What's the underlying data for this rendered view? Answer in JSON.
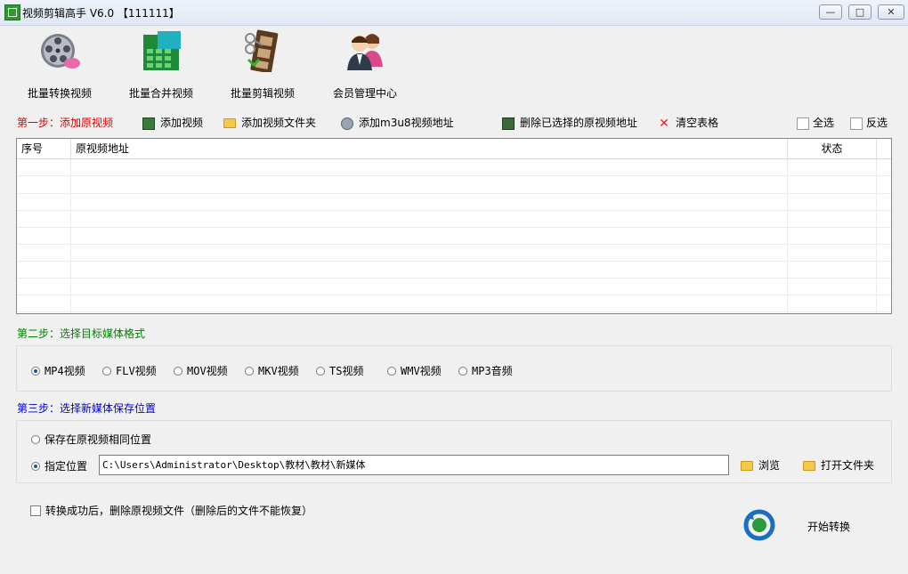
{
  "window": {
    "title": "视频剪辑高手 V6.0  【111111】",
    "buttons": {
      "minimize": "—",
      "maximize": "□",
      "close": "✕"
    }
  },
  "toolbar": {
    "items": [
      {
        "label": "批量转换视频",
        "icon": "film-reel-icon"
      },
      {
        "label": "批量合并视频",
        "icon": "merge-grid-icon"
      },
      {
        "label": "批量剪辑视频",
        "icon": "film-scissors-icon"
      },
      {
        "label": "会员管理中心",
        "icon": "users-icon"
      }
    ]
  },
  "step1": {
    "title": "第一步：添加原视频",
    "actions": {
      "add_video": "添加视频",
      "add_folder": "添加视频文件夹",
      "add_m3u8": "添加m3u8视频地址",
      "delete_selected": "删除已选择的原视频地址",
      "clear_table": "清空表格",
      "select_all": "全选",
      "invert": "反选"
    },
    "table": {
      "columns": [
        "序号",
        "原视频地址",
        "状态"
      ],
      "rows": []
    }
  },
  "step2": {
    "title": "第二步：选择目标媒体格式",
    "formats": [
      "MP4视频",
      "FLV视频",
      "MOV视频",
      "MKV视频",
      "TS视频",
      "WMV视频",
      "MP3音频"
    ],
    "selected": "MP4视频"
  },
  "step3": {
    "title": "第三步：选择新媒体保存位置",
    "option_same": "保存在原视频相同位置",
    "option_custom": "指定位置",
    "selected": "指定位置",
    "path": "C:\\Users\\Administrator\\Desktop\\教材\\教材\\新媒体",
    "browse": "浏览",
    "open_folder": "打开文件夹"
  },
  "footer": {
    "delete_after": "转换成功后，删除原视频文件（删除后的文件不能恢复）",
    "start": "开始转换"
  },
  "colors": {
    "step1": "#e00000",
    "step2": "#008000",
    "step3": "#0000cc"
  }
}
